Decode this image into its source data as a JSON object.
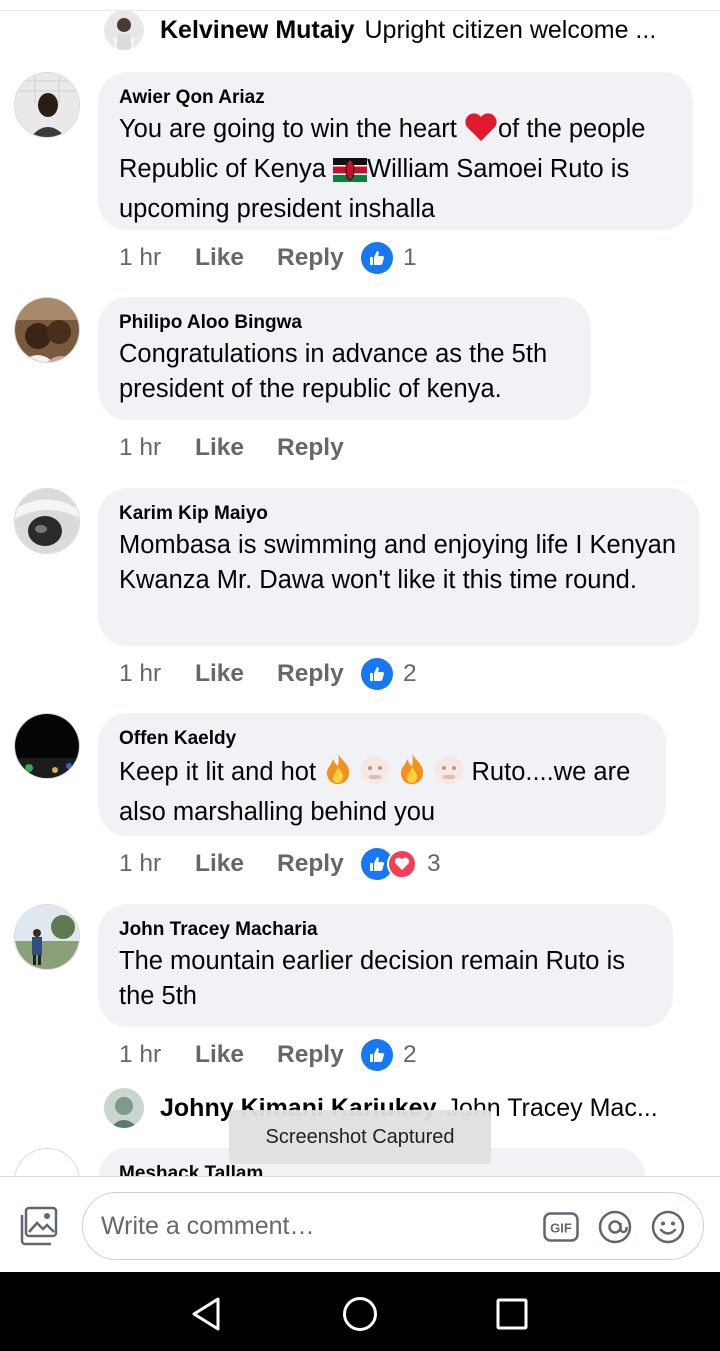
{
  "top_reply": {
    "name": "Kelvinew Mutaiy",
    "text": "Upright citizen welcome ..."
  },
  "comments": [
    {
      "author": "Awier Qon Ariaz",
      "text_before_heart": "You are going to win the heart ",
      "text_mid": "of the people Republic of Kenya ",
      "text_after_flag": "William Samoei Ruto is upcoming president inshalla",
      "time": "1 hr",
      "like": "Like",
      "reply": "Reply",
      "reaction_count": "1"
    },
    {
      "author": "Philipo Aloo Bingwa",
      "text": "Congratulations in advance as the 5th president of the republic of kenya.",
      "time": "1 hr",
      "like": "Like",
      "reply": "Reply"
    },
    {
      "author": "Karim Kip Maiyo",
      "text": "Mombasa is swimming and enjoying life I Kenyan Kwanza Mr. Dawa won't like it this time round.",
      "time": "1 hr",
      "like": "Like",
      "reply": "Reply",
      "reaction_count": "2"
    },
    {
      "author": "Offen Kaeldy",
      "text_a": "Keep it lit and hot ",
      "text_b": " Ruto....we are also marshalling behind you",
      "time": "1 hr",
      "like": "Like",
      "reply": "Reply",
      "reaction_count": "3"
    },
    {
      "author": "John Tracey Macharia",
      "text": "The mountain earlier decision remain Ruto is the 5th",
      "time": "1 hr",
      "like": "Like",
      "reply": "Reply",
      "reaction_count": "2"
    }
  ],
  "bottom_reply": {
    "name": "Johny Kimani Kariukey",
    "text": "John Tracey Mac..."
  },
  "partial_comment": {
    "author": "Meshack Tallam"
  },
  "toast": "Screenshot Captured",
  "composer": {
    "placeholder": "Write a comment…",
    "gif_label": "GIF"
  },
  "colors": {
    "like_blue": "#1877f2",
    "love_red": "#f33e58",
    "bubble_bg": "#f0f2f5",
    "meta_gray": "#65676b"
  }
}
